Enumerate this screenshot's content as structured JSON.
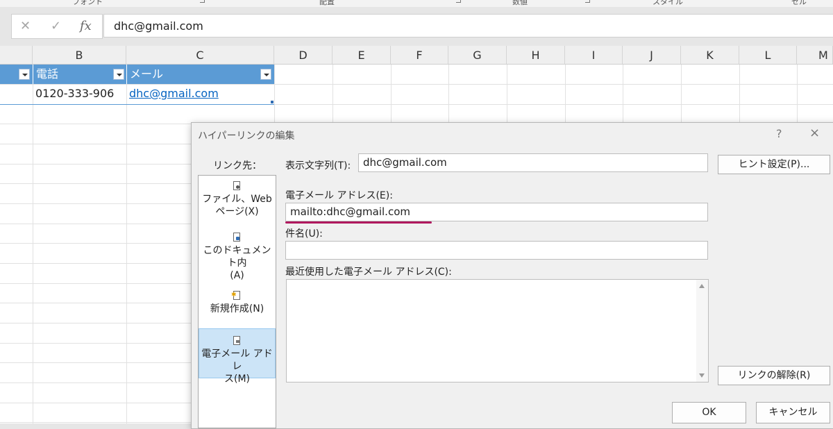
{
  "ribbon": {
    "groups": [
      "フォント",
      "配置",
      "数値",
      "スタイル",
      "セル"
    ]
  },
  "formula_bar": {
    "cancel_icon": "x-icon",
    "enter_icon": "check-icon",
    "fx_label": "fx",
    "value": "dhc@gmail.com"
  },
  "sheet": {
    "columns": [
      "B",
      "C",
      "D",
      "E",
      "F",
      "G",
      "H",
      "I",
      "J",
      "K",
      "L",
      "M"
    ],
    "table": {
      "headers": [
        "電話",
        "メール"
      ],
      "row": {
        "phone": "0120-333-906",
        "email": "dhc@gmail.com"
      }
    },
    "colors": {
      "header_bg": "#5b9bd5",
      "link": "#0563c1"
    }
  },
  "dialog": {
    "title": "ハイパーリンクの編集",
    "help": "?",
    "close": "×",
    "link_to_label": "リンク先：",
    "link_to_items": [
      {
        "line1": "ファイル、Web",
        "line2": "ページ(X)",
        "icon": "web-page-icon"
      },
      {
        "line1": "このドキュメント内",
        "line2": "(A)",
        "icon": "document-icon"
      },
      {
        "line1": "新規作成(N)",
        "line2": "",
        "icon": "new-document-icon"
      },
      {
        "line1": "電子メール アドレ",
        "line2": "ス(M)",
        "icon": "email-icon"
      }
    ],
    "display_text_label": "表示文字列(T):",
    "display_text_value": "dhc@gmail.com",
    "screentip_button": "ヒント設定(P)...",
    "email_label": "電子メール アドレス(E):",
    "email_value": "mailto:dhc@gmail.com",
    "subject_label": "件名(U):",
    "subject_value": "",
    "recent_label": "最近使用した電子メール アドレス(C):",
    "remove_link_button": "リンクの解除(R)",
    "ok_button": "OK",
    "cancel_button": "キャンセル",
    "annotation_color": "#b0185e"
  }
}
